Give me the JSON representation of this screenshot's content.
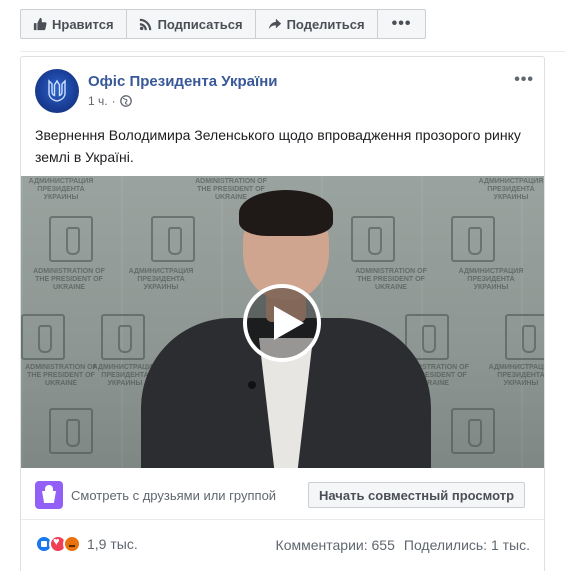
{
  "top_bar": {
    "like_label": "Нравится",
    "subscribe_label": "Подписаться",
    "share_label": "Поделиться",
    "more_label": "•••"
  },
  "post": {
    "page_name": "Офіс Президента України",
    "time": "1 ч.",
    "dot": "·",
    "menu_label": "•••",
    "text": "Звернення Володимира Зеленського щодо впровадження прозорого ринку землі в Україні."
  },
  "video": {
    "watermark_lines": [
      "АДМИНИСТРАЦИЯ ПРЕЗИДЕНТА УКРАИНЫ",
      "ADMINISTRATION OF THE PRESIDENT OF UKRAINE"
    ]
  },
  "watch_party": {
    "text": "Смотреть с друзьями или группой",
    "button_label": "Начать совместный просмотр"
  },
  "engagement": {
    "reactions_count": "1,9 тыс.",
    "comments": "Комментарии: 655",
    "shares": "Поделились: 1 тыс."
  },
  "colors": {
    "link_blue": "#385898",
    "like_blue": "#1877f2",
    "love_red": "#f33e58",
    "angry_orange": "#e9710f",
    "watch_party_purple": "#9360f7"
  },
  "icons": [
    "thumbs-up-icon",
    "rss-icon",
    "share-arrow-icon",
    "more-icon",
    "trident-icon",
    "globe-icon",
    "play-icon",
    "watch-party-icon",
    "like-reaction-icon",
    "love-reaction-icon",
    "angry-reaction-icon"
  ]
}
